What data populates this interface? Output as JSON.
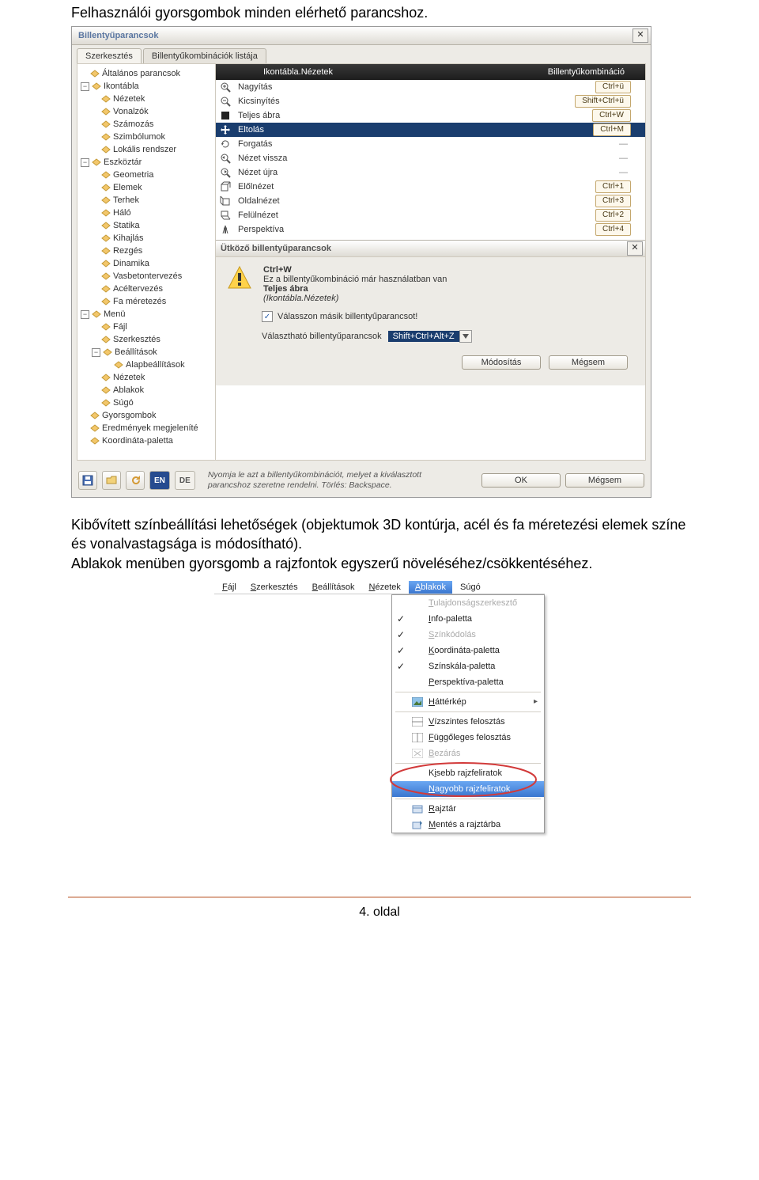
{
  "doc": {
    "heading1": "Felhasználói gyorsgombok minden elérhető parancshoz.",
    "para2_a": "Kibővített színbeállítási lehetőségek (objektumok 3D kontúrja, acél és fa méretezési elemek színe és vonalvastagsága is módosítható).",
    "para2_b": "Ablakok menüben gyorsgomb a rajzfontok egyszerű növeléséhez/csökkentéséhez.",
    "page": "4. oldal"
  },
  "dialog1": {
    "title": "Billentyűparancsok",
    "tab_edit": "Szerkesztés",
    "tab_list": "Billentyűkombinációk listája",
    "tree": {
      "n_general": "Általános parancsok",
      "n_ikon": "Ikontábla",
      "n_nezetek": "Nézetek",
      "n_vonalzok": "Vonalzók",
      "n_szamozas": "Számozás",
      "n_szimbolumok": "Szimbólumok",
      "n_lokalis": "Lokális rendszer",
      "n_eszkoztar": "Eszköztár",
      "n_geometria": "Geometria",
      "n_elemek": "Elemek",
      "n_terhek": "Terhek",
      "n_halo": "Háló",
      "n_statika": "Statika",
      "n_kihajlas": "Kihajlás",
      "n_rezges": "Rezgés",
      "n_dinamika": "Dinamika",
      "n_vasbeton": "Vasbetontervezés",
      "n_acel": "Acéltervezés",
      "n_fa": "Fa méretezés",
      "n_menu": "Menü",
      "n_fajl": "Fájl",
      "n_szerk": "Szerkesztés",
      "n_beall": "Beállítások",
      "n_alap": "Alapbeállítások",
      "n_mnezetek": "Nézetek",
      "n_ablakok": "Ablakok",
      "n_sugo": "Súgó",
      "n_gyors": "Gyorsgombok",
      "n_eredmeny": "Eredmények megjeleníté",
      "n_koord": "Koordináta-paletta"
    },
    "cmd": {
      "head_name": "Ikontábla.Nézetek",
      "head_key": "Billentyűkombináció",
      "rows": [
        {
          "icon": "zoom-in",
          "label": "Nagyítás",
          "key": "Ctrl+ü"
        },
        {
          "icon": "zoom-out",
          "label": "Kicsinyítés",
          "key": "Shift+Ctrl+ü"
        },
        {
          "icon": "fit",
          "label": "Teljes ábra",
          "key": "Ctrl+W"
        },
        {
          "icon": "pan",
          "label": "Eltolás",
          "key": "Ctrl+M",
          "sel": true
        },
        {
          "icon": "rotate",
          "label": "Forgatás",
          "key": "—"
        },
        {
          "icon": "undo-view",
          "label": "Nézet vissza",
          "key": "—"
        },
        {
          "icon": "redo-view",
          "label": "Nézet újra",
          "key": "—"
        },
        {
          "icon": "front",
          "label": "Előlnézet",
          "key": "Ctrl+1"
        },
        {
          "icon": "side",
          "label": "Oldalnézet",
          "key": "Ctrl+3"
        },
        {
          "icon": "top",
          "label": "Felülnézet",
          "key": "Ctrl+2"
        },
        {
          "icon": "persp",
          "label": "Perspektíva",
          "key": "Ctrl+4"
        }
      ]
    },
    "conflict": {
      "title": "Ütköző billentyűparancsok",
      "kc": "Ctrl+W",
      "msg": "Ez a billentyűkombináció már használatban van",
      "cmd_bold": "Teljes ábra",
      "cmd_it": "(Ikontábla.Nézetek)",
      "check_label": "Válasszon másik billentyűparancsot!",
      "combo_label": "Választható billentyűparancsok",
      "combo_val": "Shift+Ctrl+Alt+Z",
      "btn_mod": "Módosítás",
      "btn_cancel": "Mégsem"
    },
    "foot": {
      "hint1": "Nyomja le azt a billentyűkombinációt, melyet a kiválasztott",
      "hint2": "parancshoz szeretne rendelni. Törlés: Backspace.",
      "lang_en": "EN",
      "lang_de": "DE",
      "btn_ok": "OK",
      "btn_cancel": "Mégsem"
    }
  },
  "menu2": {
    "bar": {
      "fajl": "Fájl",
      "szerk": "Szerkesztés",
      "beall": "Beállítások",
      "nezet": "Nézetek",
      "ablakok": "Ablakok",
      "sugo": "Súgó"
    },
    "items": {
      "tulajd": "Tulajdonságszerkesztő",
      "info": "Info-paletta",
      "szinkod": "Színkódolás",
      "koord": "Koordináta-paletta",
      "szinskala": "Színskála-paletta",
      "persp": "Perspektíva-paletta",
      "hatter": "Háttérkép",
      "vizsz": "Vízszintes felosztás",
      "fugg": "Függőleges felosztás",
      "bezar": "Bezárás",
      "kisebb": "Kisebb rajzfeliratok",
      "nagyobb": "Nagyobb rajzfeliratok",
      "rajztar": "Rajztár",
      "mentes": "Mentés a rajztárba"
    }
  }
}
